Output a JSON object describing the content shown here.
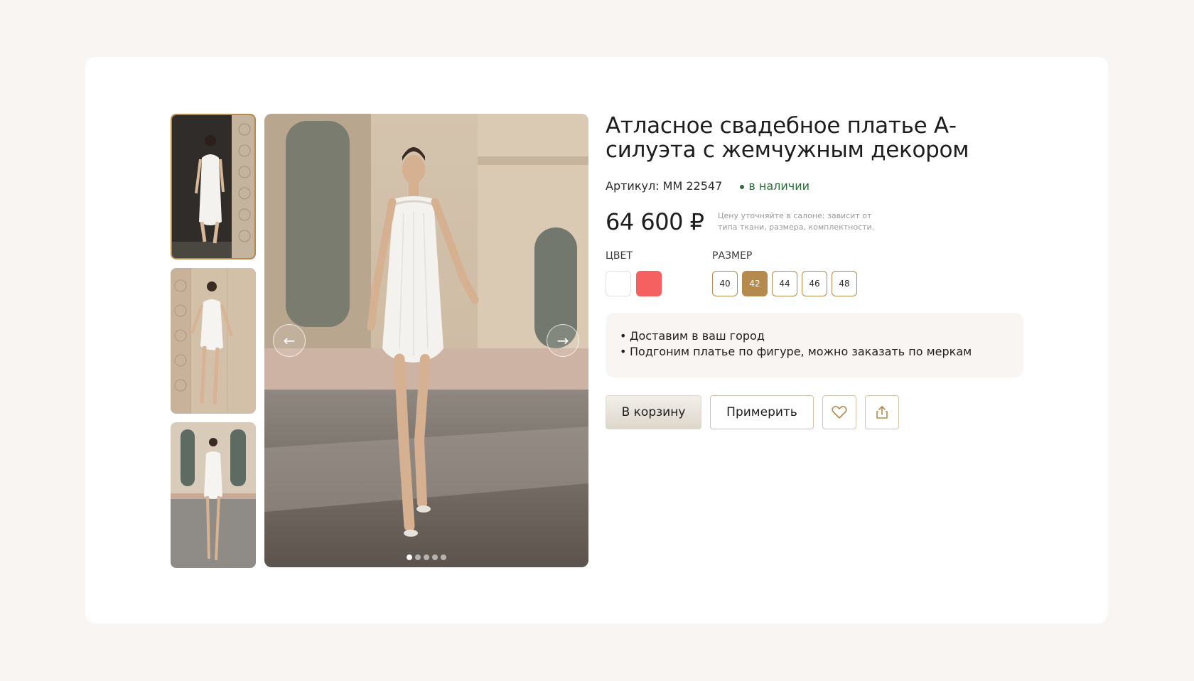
{
  "product": {
    "title": "Атласное свадебное платье А-силуэта с жемчужным декором",
    "article_label": "Артикул:",
    "article_value": "ММ 22547",
    "stock": "в наличии",
    "price": "64 600 ₽",
    "price_note": "Цену уточняйте в салоне: зависит от типа ткани, размера, комплектности."
  },
  "gallery": {
    "thumbnails": [
      "thumb-back-view",
      "thumb-wall-pose",
      "thumb-full-length"
    ],
    "active_thumbnail": 0,
    "prev_icon": "←",
    "next_icon": "→",
    "dot_count": 5,
    "active_dot": 0
  },
  "color": {
    "label": "ЦВЕТ",
    "options": [
      {
        "name": "white",
        "hex": "#ffffff"
      },
      {
        "name": "coral",
        "hex": "#f56060"
      }
    ]
  },
  "size": {
    "label": "РАЗМЕР",
    "options": [
      "40",
      "42",
      "44",
      "46",
      "48"
    ],
    "selected": "42"
  },
  "benefits": [
    "Доставим в ваш город",
    "Подгоним платье по фигуре, можно заказать по меркам"
  ],
  "actions": {
    "cart_label": "В корзину",
    "try_label": "Примерить",
    "favorite_icon": "heart-icon",
    "share_icon": "share-icon"
  },
  "colors": {
    "accent": "#b58a4c",
    "in_stock": "#2e6b3a",
    "page_bg": "#f8f5f2"
  }
}
